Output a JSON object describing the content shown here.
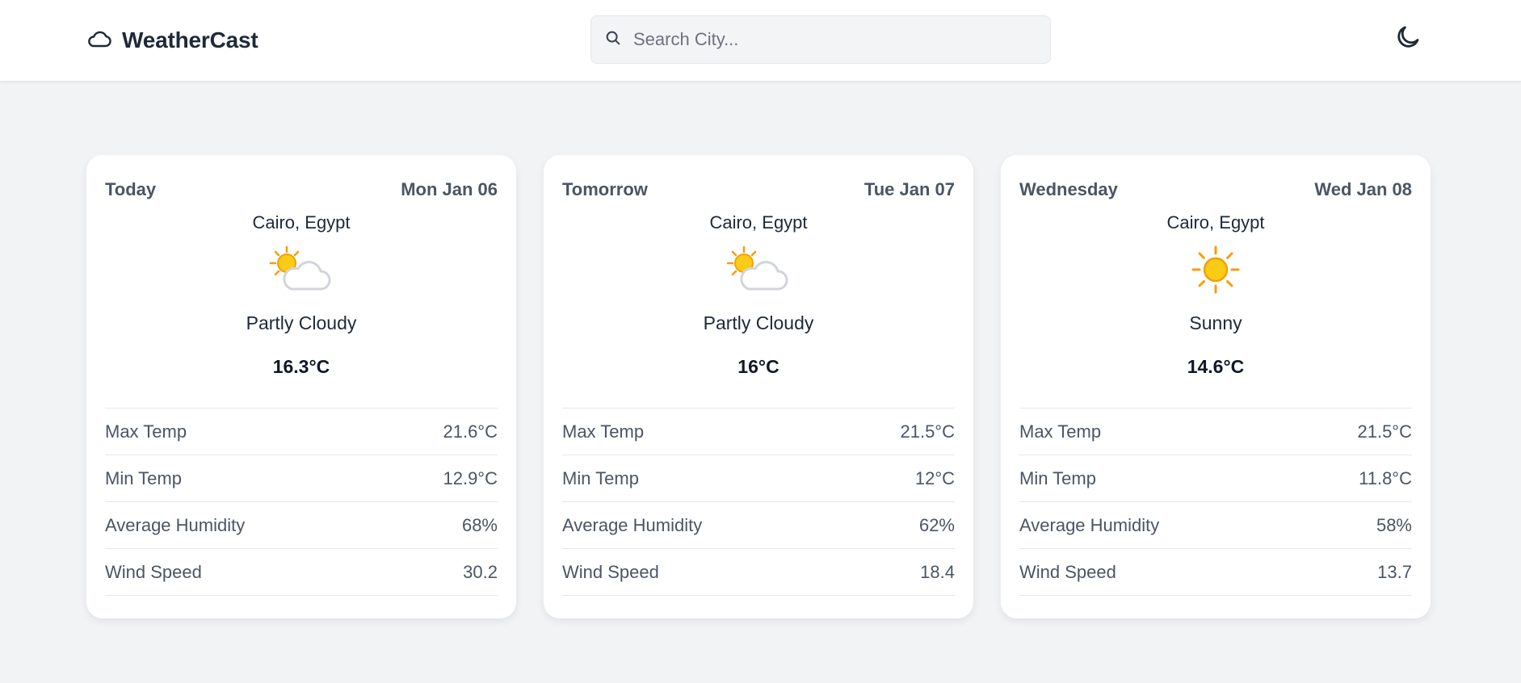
{
  "header": {
    "brand": "WeatherCast",
    "search_placeholder": "Search City...",
    "search_value": ""
  },
  "colors": {
    "page_bg": "#f2f3f5",
    "card_bg": "#ffffff",
    "text_primary": "#1f2937",
    "text_secondary": "#4b5563",
    "sun_yellow": "#facc15",
    "sun_orange": "#f59e0b",
    "cloud_gray": "#d1d5db"
  },
  "forecast": [
    {
      "day": "Today",
      "date": "Mon Jan 06",
      "location": "Cairo, Egypt",
      "icon": "partly-cloudy-icon",
      "condition": "Partly Cloudy",
      "temp": "16.3°C",
      "stats": [
        {
          "label": "Max Temp",
          "value": "21.6°C"
        },
        {
          "label": "Min Temp",
          "value": "12.9°C"
        },
        {
          "label": "Average Humidity",
          "value": "68%"
        },
        {
          "label": "Wind Speed",
          "value": "30.2"
        }
      ]
    },
    {
      "day": "Tomorrow",
      "date": "Tue Jan 07",
      "location": "Cairo, Egypt",
      "icon": "partly-cloudy-icon",
      "condition": "Partly Cloudy",
      "temp": "16°C",
      "stats": [
        {
          "label": "Max Temp",
          "value": "21.5°C"
        },
        {
          "label": "Min Temp",
          "value": "12°C"
        },
        {
          "label": "Average Humidity",
          "value": "62%"
        },
        {
          "label": "Wind Speed",
          "value": "18.4"
        }
      ]
    },
    {
      "day": "Wednesday",
      "date": "Wed Jan 08",
      "location": "Cairo, Egypt",
      "icon": "sunny-icon",
      "condition": "Sunny",
      "temp": "14.6°C",
      "stats": [
        {
          "label": "Max Temp",
          "value": "21.5°C"
        },
        {
          "label": "Min Temp",
          "value": "11.8°C"
        },
        {
          "label": "Average Humidity",
          "value": "58%"
        },
        {
          "label": "Wind Speed",
          "value": "13.7"
        }
      ]
    }
  ]
}
